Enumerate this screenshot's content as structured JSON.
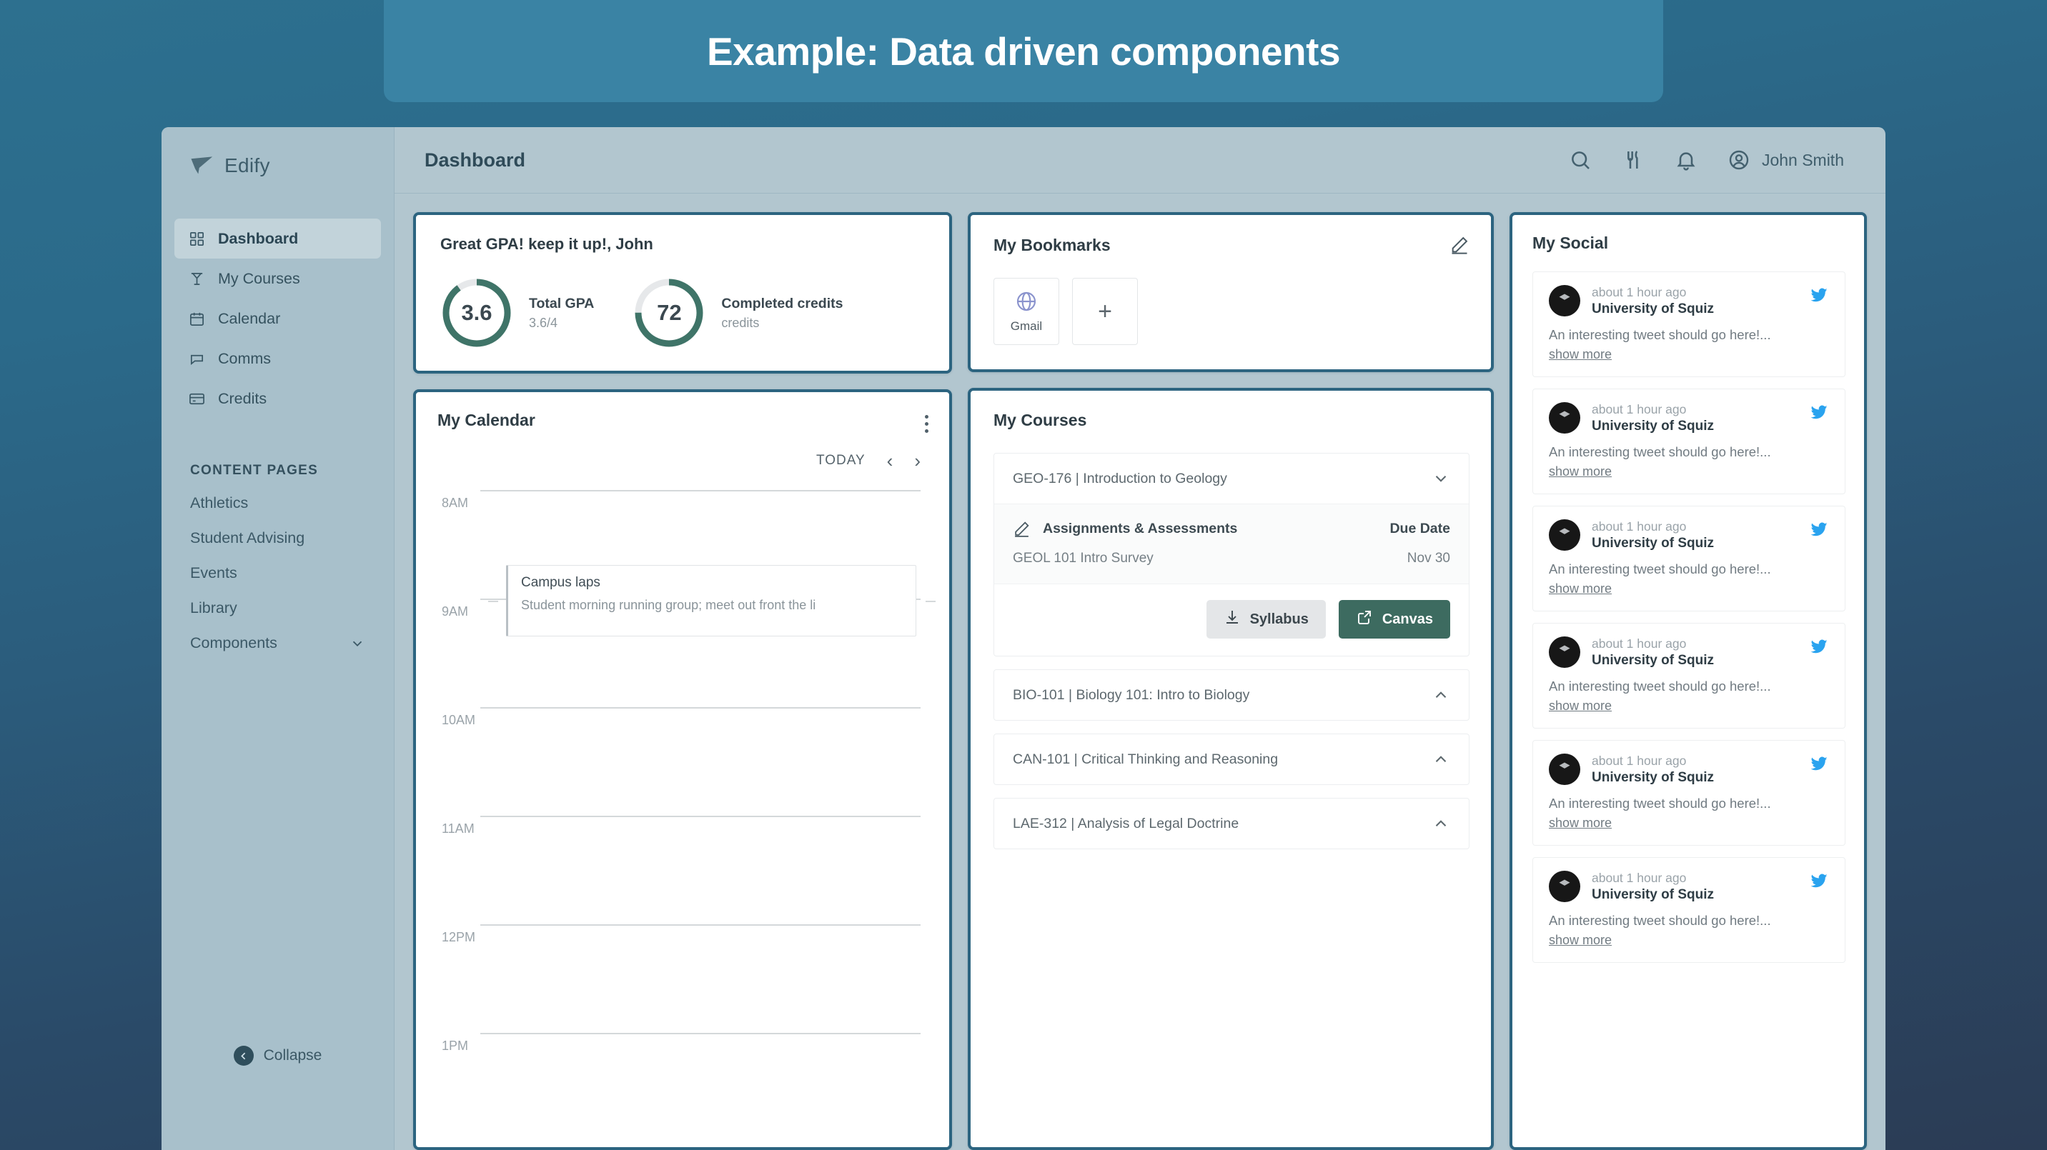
{
  "banner": {
    "title": "Example: Data driven components"
  },
  "sidebar": {
    "brand": "Edify",
    "nav": [
      {
        "label": "Dashboard",
        "icon": "dashboard-icon"
      },
      {
        "label": "My Courses",
        "icon": "courses-icon"
      },
      {
        "label": "Calendar",
        "icon": "calendar-icon"
      },
      {
        "label": "Comms",
        "icon": "comms-icon"
      },
      {
        "label": "Credits",
        "icon": "credits-icon"
      }
    ],
    "section_label": "CONTENT PAGES",
    "pages": [
      {
        "label": "Athletics",
        "expandable": false
      },
      {
        "label": "Student Advising",
        "expandable": false
      },
      {
        "label": "Events",
        "expandable": false
      },
      {
        "label": "Library",
        "expandable": false
      },
      {
        "label": "Components",
        "expandable": true
      }
    ],
    "collapse_label": "Collapse"
  },
  "topbar": {
    "page_title": "Dashboard",
    "icons": [
      "search-icon",
      "dining-icon",
      "bell-icon"
    ],
    "user_name": "John Smith"
  },
  "gpa_card": {
    "heading": "Great GPA! keep it up!, John",
    "stats": [
      {
        "value": "3.6",
        "label": "Total GPA",
        "sub": "3.6/4",
        "percent": 90
      },
      {
        "value": "72",
        "label": "Completed credits",
        "sub": "credits",
        "percent": 75
      }
    ],
    "ring_color": "#3f7468",
    "track_color": "#e6e8ea"
  },
  "bookmarks_card": {
    "title": "My Bookmarks",
    "edit_icon": "pencil-icon",
    "tiles": [
      {
        "label": "Gmail",
        "icon": "globe-icon"
      }
    ],
    "add_label": "+"
  },
  "calendar_card": {
    "title": "My Calendar",
    "menu_icon": "kebab-menu-icon",
    "today_label": "TODAY",
    "prev_label": "‹",
    "next_label": "›",
    "hours": [
      "8AM",
      "9AM",
      "10AM",
      "11AM",
      "12PM",
      "1PM"
    ],
    "events": [
      {
        "title": "Campus laps",
        "description": "Student morning running group; meet out front the li"
      }
    ]
  },
  "courses_card": {
    "title": "My Courses",
    "courses": [
      {
        "label": "GEO-176 | Introduction to Geology",
        "expanded": true,
        "assignments_header": "Assignments & Assessments",
        "due_header": "Due Date",
        "assignments": [
          {
            "name": "GEOL 101 Intro Survey",
            "due": "Nov 30"
          }
        ],
        "buttons": [
          {
            "label": "Syllabus",
            "icon": "download-icon",
            "style": "grey"
          },
          {
            "label": "Canvas",
            "icon": "external-link-icon",
            "style": "green"
          }
        ]
      },
      {
        "label": "BIO-101 | Biology 101: Intro to Biology",
        "expanded": false
      },
      {
        "label": "CAN-101 | Critical Thinking and Reasoning",
        "expanded": false
      },
      {
        "label": "LAE-312 | Analysis of Legal Doctrine",
        "expanded": false
      }
    ]
  },
  "social_card": {
    "title": "My Social",
    "tweets": [
      {
        "time": "about 1 hour ago",
        "name": "University of Squiz",
        "body": "An interesting tweet should go here!...",
        "more": "show more"
      },
      {
        "time": "about 1 hour ago",
        "name": "University of Squiz",
        "body": "An interesting tweet should go here!...",
        "more": "show more"
      },
      {
        "time": "about 1 hour ago",
        "name": "University of Squiz",
        "body": "An interesting tweet should go here!...",
        "more": "show more"
      },
      {
        "time": "about 1 hour ago",
        "name": "University of Squiz",
        "body": "An interesting tweet should go here!...",
        "more": "show more"
      },
      {
        "time": "about 1 hour ago",
        "name": "University of Squiz",
        "body": "An interesting tweet should go here!...",
        "more": "show more"
      },
      {
        "time": "about 1 hour ago",
        "name": "University of Squiz",
        "body": "An interesting tweet should go here!...",
        "more": "show more"
      }
    ]
  },
  "colors": {
    "banner_bg": "#3a83a4",
    "app_bg": "#b2c6cf",
    "sidebar_bg": "#a8c0cb",
    "card_border_highlight": "#2c6480",
    "accent_green": "#3d6b60",
    "twitter_blue": "#2aa3ef"
  }
}
